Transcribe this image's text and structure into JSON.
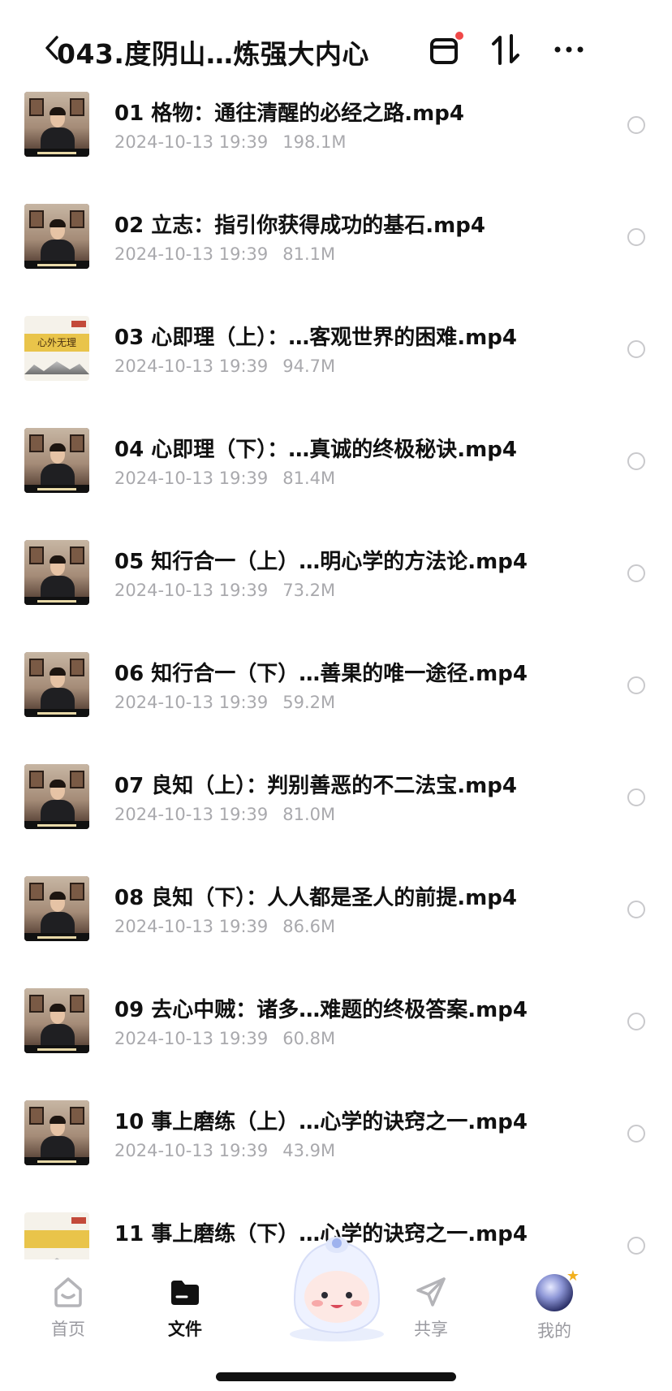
{
  "header": {
    "title": "043.度阴山…炼强大内心"
  },
  "files": [
    {
      "name": "01 格物：通往清醒的必经之路.mp4",
      "date": "2024-10-13 19:39",
      "size": "198.1M",
      "thumb": "person"
    },
    {
      "name": "02 立志：指引你获得成功的基石.mp4",
      "date": "2024-10-13 19:39",
      "size": "81.1M",
      "thumb": "person"
    },
    {
      "name": "03 心即理（上）：…客观世界的困难.mp4",
      "date": "2024-10-13 19:39",
      "size": "94.7M",
      "thumb": "book",
      "thumb_text": "心外无理"
    },
    {
      "name": "04 心即理（下）：…真诚的终极秘诀.mp4",
      "date": "2024-10-13 19:39",
      "size": "81.4M",
      "thumb": "person"
    },
    {
      "name": "05 知行合一（上）…明心学的方法论.mp4",
      "date": "2024-10-13 19:39",
      "size": "73.2M",
      "thumb": "person"
    },
    {
      "name": "06 知行合一（下）…善果的唯一途径.mp4",
      "date": "2024-10-13 19:39",
      "size": "59.2M",
      "thumb": "person"
    },
    {
      "name": "07 良知（上）：判别善恶的不二法宝.mp4",
      "date": "2024-10-13 19:39",
      "size": "81.0M",
      "thumb": "person"
    },
    {
      "name": "08 良知（下）：人人都是圣人的前提.mp4",
      "date": "2024-10-13 19:39",
      "size": "86.6M",
      "thumb": "person"
    },
    {
      "name": "09 去心中贼：诸多…难题的终极答案.mp4",
      "date": "2024-10-13 19:39",
      "size": "60.8M",
      "thumb": "person"
    },
    {
      "name": "10 事上磨练（上）…心学的诀窍之一.mp4",
      "date": "2024-10-13 19:39",
      "size": "43.9M",
      "thumb": "person"
    },
    {
      "name": "11 事上磨练（下）…心学的诀窍之一.mp4",
      "date": "",
      "size": "",
      "thumb": "book",
      "thumb_text": ""
    }
  ],
  "nav": {
    "items": [
      {
        "label": "首页",
        "icon": "home-icon",
        "active": false
      },
      {
        "label": "文件",
        "icon": "folder-icon",
        "active": true
      },
      {
        "label": "共享",
        "icon": "send-icon",
        "active": false
      },
      {
        "label": "我的",
        "icon": "avatar",
        "active": false
      }
    ]
  },
  "colors": {
    "title": "#111111",
    "meta": "#a9a9ad",
    "nav_inactive": "#9a9aa0",
    "badge": "#f04848"
  }
}
